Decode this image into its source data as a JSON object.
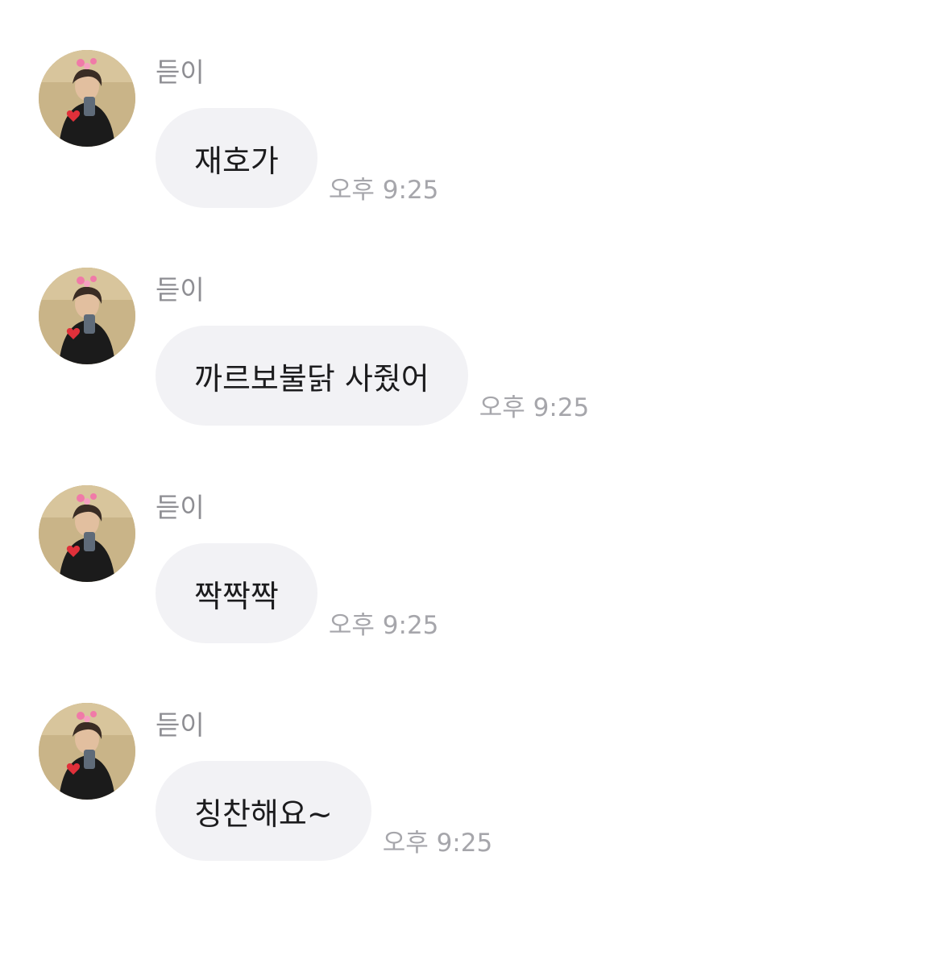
{
  "messages": [
    {
      "sender": "듣이",
      "text": "재호가",
      "time": "오후 9:25"
    },
    {
      "sender": "듣이",
      "text": "까르보불닭 사줬어",
      "time": "오후 9:25"
    },
    {
      "sender": "듣이",
      "text": "짝짝짝",
      "time": "오후 9:25"
    },
    {
      "sender": "듣이",
      "text": "칭찬해요~",
      "time": "오후 9:25"
    }
  ],
  "avatar": {
    "icon": "profile-photo-avatar"
  },
  "colors": {
    "bubble": "#f2f2f5",
    "message_text": "#1c1c1e",
    "sender_text": "#8e8e93",
    "time_text": "#a6a6ab"
  }
}
